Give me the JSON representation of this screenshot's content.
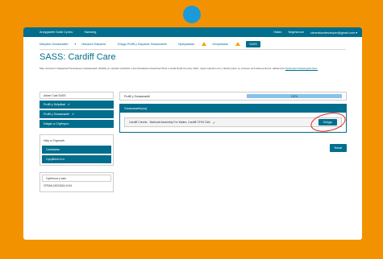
{
  "topnav": {
    "brand": "Arolygiaeth Gofal Cymru",
    "language": "Saesneg",
    "home": "Hafan",
    "notifications": "Negeseuon",
    "account": "cleverbiondeveloper@gmail.com"
  },
  "subnav": {
    "items": [
      {
        "label": "Manylion Gwasanaeth",
        "has_caret": true,
        "warning": false,
        "active": false
      },
      {
        "label": "Manylion Darparwr",
        "warning": false,
        "active": false
      },
      {
        "label": "Golygu Proffil y Darparwr Gwasanaeth",
        "warning": false,
        "active": false
      },
      {
        "label": "Hysbysiadau",
        "warning": true,
        "active": false
      },
      {
        "label": "Amrywiadau",
        "warning": true,
        "active": false
      },
      {
        "label": "SASS",
        "warning": false,
        "active": true
      }
    ]
  },
  "page": {
    "title": "SASS: Cardiff Care",
    "intro": "Mae cofrestru'r Datganiad Hunanasesu Gwasanaeth (SASS) yn ofyniad cyfreithiol o dan Reoliadau Gwarchod Plant a Gofal Dydd (Cymru) 2010. I gael manylion am y ffordd rydym yn prosesu eich data personol, darllenwch",
    "intro_link": "Hysbysiad Preifatrwydd AGC."
  },
  "sidebar": {
    "header": "Adran Cais SASS",
    "sections": [
      {
        "label": "Proffil y Sefydliad",
        "check": "✔"
      },
      {
        "label": "Proffil y Gwasanaeth",
        "check": "✔"
      },
      {
        "label": "Datgan a Chyflwyno",
        "check": ""
      }
    ],
    "help_header": "Help a Chymorth",
    "help_items": [
      "Canllawiau",
      "Cysylltwch â ni"
    ],
    "ref_header": "Cyfeirnod y cais",
    "ref_value": "CFRAN-00013316-VHJ4"
  },
  "main": {
    "progress_label": "Proffil y Gwasanaeth",
    "progress_value": 100,
    "progress_text": "100%",
    "panel_title": "Gwasanaeth(au)",
    "service_name": "Cardiff Creche - National Assembly For Wales, Cardiff CF99 1NA",
    "service_check": "✔",
    "edit_label": "Golygu",
    "next_label": "Nesaf"
  }
}
